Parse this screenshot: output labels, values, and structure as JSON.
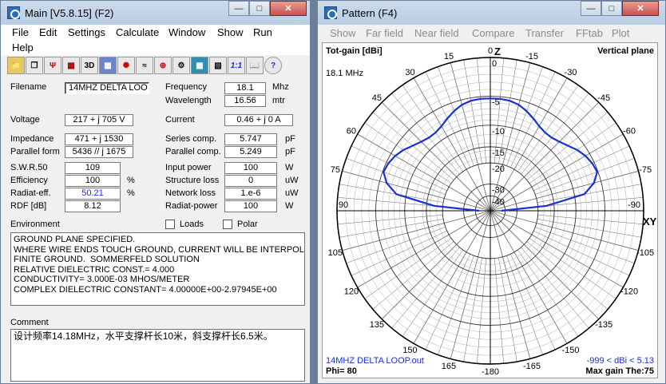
{
  "main": {
    "title": "Main [V5.8.15]  (F2)",
    "menu": [
      "File",
      "Edit",
      "Settings",
      "Calculate",
      "Window",
      "Show",
      "Run",
      "Help"
    ],
    "toolbar_icons": [
      "open-icon",
      "copy-icon",
      "antenna-icon",
      "box-icon",
      "3d-icon",
      "grid-icon",
      "pattern-icon",
      "swr-icon",
      "smith-icon",
      "tune-icon",
      "table-icon",
      "calc-icon",
      "one-to-one-icon",
      "book-icon",
      "help-icon"
    ],
    "toolbar_text": {
      "three_d": "3D",
      "one": "1:1",
      "help": "?"
    },
    "fields": {
      "filename_label": "Filename",
      "filename": "14MHZ DELTA LOO",
      "frequency_label": "Frequency",
      "frequency": "18.1",
      "frequency_unit": "Mhz",
      "wavelength_label": "Wavelength",
      "wavelength": "16.56",
      "wavelength_unit": "mtr",
      "voltage_label": "Voltage",
      "voltage": "217 + j 705 V",
      "current_label": "Current",
      "current": "0.46 + j 0 A",
      "impedance_label": "Impedance",
      "impedance": "471 + j 1530",
      "parallel_form_label": "Parallel form",
      "parallel_form": "5436 // j 1675",
      "series_comp_label": "Series comp.",
      "series_comp": "5.747",
      "series_comp_unit": "pF",
      "parallel_comp_label": "Parallel comp.",
      "parallel_comp": "5.249",
      "parallel_comp_unit": "pF",
      "swr_label": "S.W.R.50",
      "swr": "109",
      "input_power_label": "Input power",
      "input_power": "100",
      "input_power_unit": "W",
      "efficiency_label": "Efficiency",
      "efficiency": "100",
      "efficiency_unit": "%",
      "structure_loss_label": "Structure loss",
      "structure_loss": "0",
      "structure_loss_unit": "uW",
      "radiat_eff_label": "Radiat-eff.",
      "radiat_eff": "50.21",
      "radiat_eff_unit": "%",
      "network_loss_label": "Network loss",
      "network_loss": "1.e-6",
      "network_loss_unit": "uW",
      "rdf_label": "RDF [dB]",
      "rdf": "8.12",
      "radiat_power_label": "Radiat-power",
      "radiat_power": "100",
      "radiat_power_unit": "W"
    },
    "environment_label": "Environment",
    "loads_label": "Loads",
    "polar_label": "Polar",
    "environment_text": "GROUND PLANE SPECIFIED.\nWHERE WIRE ENDS TOUCH GROUND, CURRENT WILL BE INTERPOLATED\nFINITE GROUND.  SOMMERFELD SOLUTION\nRELATIVE DIELECTRIC CONST.= 4.000\nCONDUCTIVITY= 3.000E-03 MHOS/METER\nCOMPLEX DIELECTRIC CONSTANT= 4.00000E+00-2.97945E+00",
    "comment_label": "Comment",
    "comment_text": "设计频率14.18MHz，水平支撑杆长10米，斜支撑杆长6.5米。"
  },
  "pattern": {
    "title": "Pattern   (F4)",
    "menu": [
      "Show",
      "Far field",
      "Near field",
      "Compare",
      "Transfer",
      "FFtab",
      "Plot"
    ],
    "tot_gain": "Tot-gain [dBi]",
    "plane": "Vertical plane",
    "freq": "18.1 MHz",
    "z_label": "Z",
    "xy_label": "XY",
    "file": "14MHZ DELTA LOOP.out",
    "range": "-999 < dBi < 5.13",
    "phi": "Phi= 80",
    "max_gain": "Max gain The:75",
    "angle_labels": [
      "0",
      "15",
      "30",
      "45",
      "60",
      "75",
      "90",
      "105",
      "120",
      "135",
      "150",
      "165",
      "-180",
      "-165",
      "-150",
      "-135",
      "-120",
      "-105",
      "-90",
      "-75",
      "-60",
      "-45",
      "-30",
      "-15"
    ],
    "db_labels": [
      "0",
      "-5",
      "-10",
      "-15",
      "-20",
      "-30",
      "-40"
    ],
    "colors": {
      "trace": "#1a2fd4",
      "label_blue": "#1a2fd4"
    }
  },
  "chart_data": {
    "type": "polar",
    "title": "Tot-gain [dBi]",
    "subtitle": "Vertical plane",
    "r_ticks_dbi": [
      0,
      -5,
      -10,
      -15,
      -20,
      -30,
      -40
    ],
    "angle_ticks_deg": [
      0,
      15,
      30,
      45,
      60,
      75,
      90,
      105,
      120,
      135,
      150,
      165,
      180,
      -165,
      -150,
      -135,
      -120,
      -105,
      -90,
      -75,
      -60,
      -45,
      -30,
      -15
    ],
    "max_gain_dbi": 5.13,
    "series": [
      {
        "name": "14MHZ DELTA LOOP.out",
        "theta_deg": [
          -90,
          -85,
          -80,
          -75,
          -70,
          -65,
          -60,
          -55,
          -50,
          -45,
          -40,
          -35,
          -30,
          -25,
          -20,
          -15,
          -10,
          -5,
          0,
          5,
          10,
          15,
          20,
          25,
          30,
          35,
          40,
          45,
          50,
          55,
          60,
          65,
          70,
          75,
          80,
          85,
          90
        ],
        "gain_dbi": [
          -40,
          -12,
          -3,
          -1,
          0,
          -0.2,
          -0.6,
          -1.2,
          -2,
          -2.6,
          -3,
          -3,
          -2.6,
          -1.9,
          -1.2,
          -0.6,
          -0.3,
          -0.2,
          -0.2,
          -0.2,
          -0.3,
          -0.6,
          -1.2,
          -1.9,
          -2.6,
          -3,
          -3,
          -2.6,
          -2,
          -1.2,
          -0.6,
          -0.2,
          0,
          -1,
          -3,
          -12,
          -40
        ]
      }
    ]
  }
}
